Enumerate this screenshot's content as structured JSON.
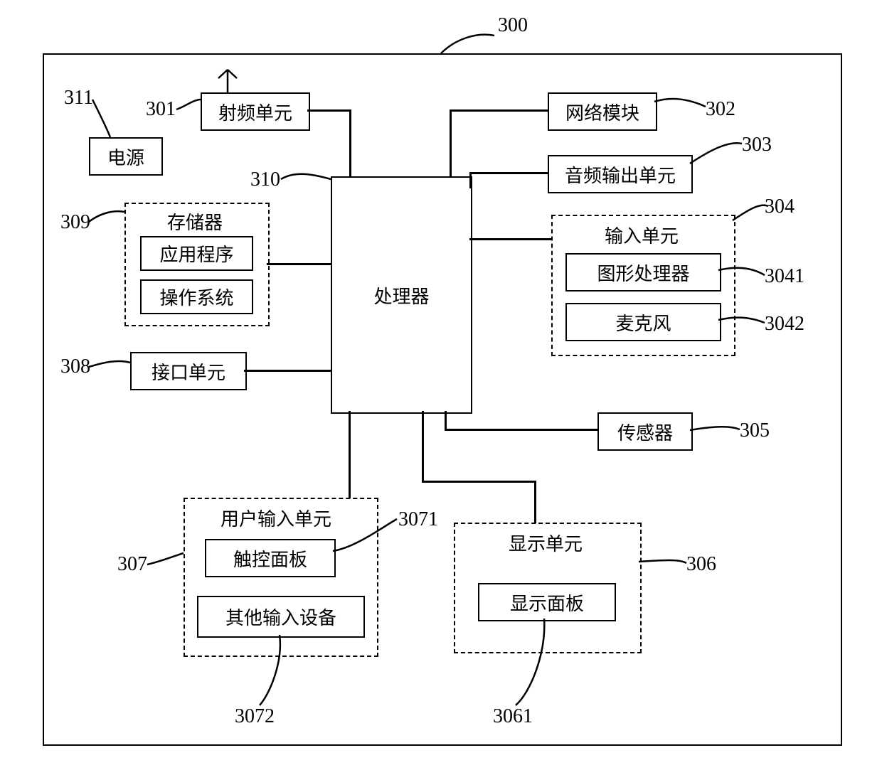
{
  "device": {
    "ref": "300"
  },
  "processor": {
    "label": "处理器",
    "ref": "310"
  },
  "rf_unit": {
    "label": "射频单元",
    "ref": "301"
  },
  "power": {
    "label": "电源",
    "ref": "311"
  },
  "network": {
    "label": "网络模块",
    "ref": "302"
  },
  "audio_out": {
    "label": "音频输出单元",
    "ref": "303"
  },
  "memory": {
    "title": "存储器",
    "ref": "309",
    "apps": {
      "label": "应用程序"
    },
    "os": {
      "label": "操作系统"
    }
  },
  "input_unit": {
    "title": "输入单元",
    "ref": "304",
    "gpu": {
      "label": "图形处理器",
      "ref": "3041"
    },
    "mic": {
      "label": "麦克风",
      "ref": "3042"
    }
  },
  "interface": {
    "label": "接口单元",
    "ref": "308"
  },
  "sensor": {
    "label": "传感器",
    "ref": "305"
  },
  "user_input": {
    "title": "用户输入单元",
    "ref": "307",
    "touch": {
      "label": "触控面板",
      "ref": "3071"
    },
    "other": {
      "label": "其他输入设备",
      "ref": "3072"
    }
  },
  "display_unit": {
    "title": "显示单元",
    "ref": "306",
    "panel": {
      "label": "显示面板",
      "ref": "3061"
    }
  }
}
